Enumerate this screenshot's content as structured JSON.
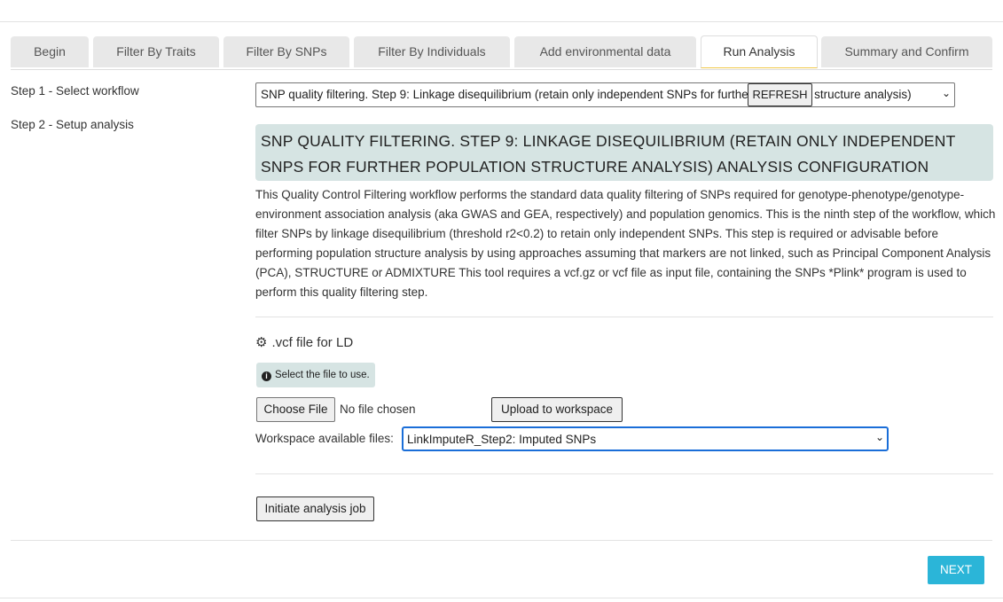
{
  "tabs": [
    {
      "label": "Begin"
    },
    {
      "label": "Filter By Traits"
    },
    {
      "label": "Filter By SNPs"
    },
    {
      "label": "Filter By Individuals"
    },
    {
      "label": "Add environmental data"
    },
    {
      "label": "Run Analysis",
      "active": true
    },
    {
      "label": "Summary and Confirm"
    }
  ],
  "steps": [
    {
      "label": "Step 1 - Select workflow"
    },
    {
      "label": "Step 2 - Setup analysis"
    }
  ],
  "workflow": {
    "selected": "SNP quality filtering. Step 9: Linkage disequilibrium (retain only independent SNPs for further population structure analysis)",
    "refresh_label": "REFRESH",
    "config_title": "SNP quality filtering. Step 9: Linkage disequilibrium (retain only independent SNPs for further population structure analysis) analysis configuration",
    "description": "This Quality Control Filtering workflow performs the standard data quality filtering of SNPs required for genotype-phenotype/genotype-environment association analysis (aka GWAS and GEA, respectively) and population genomics. This is the ninth step of the workflow, which filter SNPs by linkage disequilibrium (threshold r2<0.2) to retain only independent SNPs. This step is required or advisable before performing population structure analysis by using approaches assuming that markers are not linked, such as Principal Component Analysis (PCA), STRUCTURE or ADMIXTURE This tool requires a vcf.gz or vcf file as input file, containing the SNPs *Plink* program is used to perform this quality filtering step."
  },
  "param": {
    "icon": "gear-icon",
    "title": ".vcf file for LD",
    "hint": "Select the file to use.",
    "choose_file_label": "Choose File",
    "no_file_text": "No file chosen",
    "upload_label": "Upload to workspace",
    "workspace_label": "Workspace available files:",
    "workspace_selected": "LinkImputeR_Step2: Imputed SNPs"
  },
  "actions": {
    "initiate_label": "Initiate analysis job",
    "next_label": "NEXT"
  },
  "colors": {
    "header_bg": "#d6e4e3",
    "next_bg": "#2bb5d8",
    "active_tab_underline": "#f0c84a",
    "focus_border": "#1a6ed8"
  }
}
